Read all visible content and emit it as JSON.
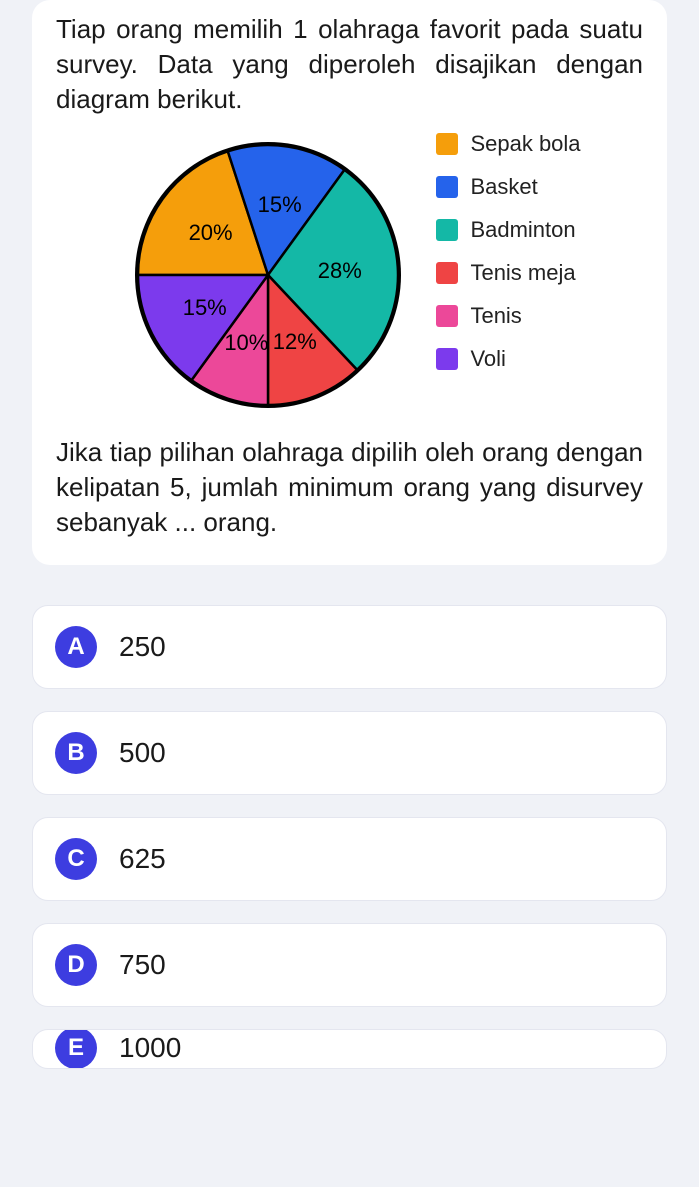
{
  "question": {
    "text_before": "Tiap orang memilih 1 olahraga favorit pada suatu survey. Data yang diperoleh disajikan dengan diagram berikut.",
    "text_after": "Jika tiap pilihan olahraga dipilih oleh orang dengan kelipatan 5, jumlah minimum orang yang disurvey sebanyak ... orang."
  },
  "chart_data": {
    "type": "pie",
    "title": "",
    "series": [
      {
        "name": "Sepak bola",
        "value": 20,
        "label": "20%",
        "color": "#f59e0b"
      },
      {
        "name": "Basket",
        "value": 15,
        "label": "15%",
        "color": "#2563eb"
      },
      {
        "name": "Badminton",
        "value": 28,
        "label": "28%",
        "color": "#14b8a6"
      },
      {
        "name": "Tenis meja",
        "value": 12,
        "label": "12%",
        "color": "#ef4444"
      },
      {
        "name": "Tenis",
        "value": 10,
        "label": "10%",
        "color": "#ec4899"
      },
      {
        "name": "Voli",
        "value": 15,
        "label": "15%",
        "color": "#7c3aed"
      }
    ],
    "start_at_top_ccw_first": false
  },
  "options": [
    {
      "letter": "A",
      "text": "250"
    },
    {
      "letter": "B",
      "text": "500"
    },
    {
      "letter": "C",
      "text": "625"
    },
    {
      "letter": "D",
      "text": "750"
    },
    {
      "letter": "E",
      "text": "1000"
    }
  ]
}
